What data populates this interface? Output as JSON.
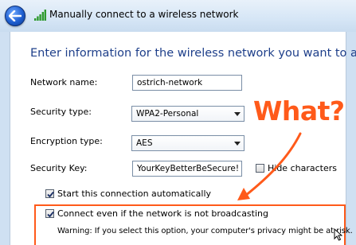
{
  "window": {
    "title": "Manually connect to a wireless network"
  },
  "main": {
    "heading": "Enter information for the wireless network you want to add",
    "fields": {
      "network_name": {
        "label": "Network name:",
        "value": "ostrich-network"
      },
      "security_type": {
        "label": "Security type:",
        "value": "WPA2-Personal"
      },
      "encryption_type": {
        "label": "Encryption type:",
        "value": "AES"
      },
      "security_key": {
        "label": "Security Key:",
        "value": "YourKeyBetterBeSecure!"
      }
    },
    "hide_characters": {
      "label": "Hide characters",
      "checked": false
    },
    "start_automatically": {
      "label": "Start this connection automatically",
      "checked": true
    },
    "connect_broadcast": {
      "label": "Connect even if the network is not broadcasting",
      "checked": true
    },
    "warning": "Warning: If you select this option, your computer's privacy might be at risk."
  },
  "annotation": {
    "text": "What?",
    "color": "#ff5a1a"
  },
  "icons": {
    "back": "back-arrow-icon",
    "wifi": "wireless-signal-icon",
    "cursor": "mouse-pointer-icon"
  }
}
